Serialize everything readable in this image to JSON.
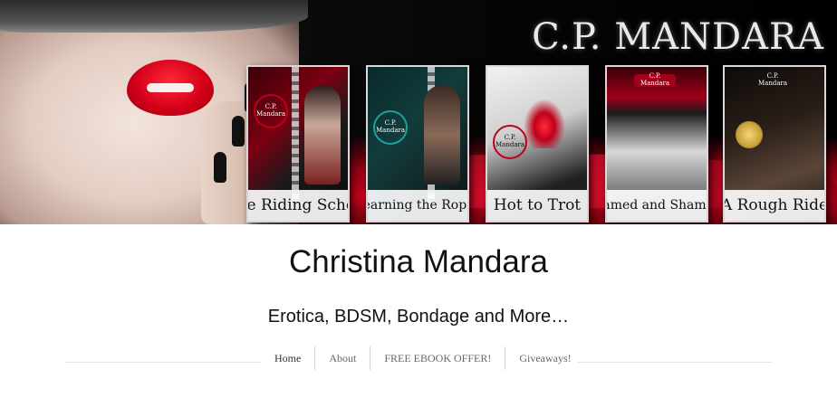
{
  "banner": {
    "brand_text": "C.P. MANDARA",
    "books": [
      {
        "title": "The Riding School",
        "author": "C.P. Mandara",
        "accent": "#c0001a"
      },
      {
        "title": "Learning the Ropes",
        "author": "C.P. Mandara",
        "accent": "#1aa39a"
      },
      {
        "title": "Hot to Trot",
        "author": "C.P. Mandara",
        "accent": "#c0001a"
      },
      {
        "title": "Named and Shamed",
        "author": "C.P. Mandara",
        "accent": "#c0001a"
      },
      {
        "title": "A Rough Ride",
        "author": "C.P. Mandara",
        "accent": "#c0001a"
      }
    ]
  },
  "site": {
    "title": "Christina Mandara",
    "tagline": "Erotica, BDSM, Bondage and More…"
  },
  "nav": {
    "items": [
      {
        "label": "Home",
        "active": true
      },
      {
        "label": "About",
        "active": false
      },
      {
        "label": "FREE EBOOK OFFER!",
        "active": false
      },
      {
        "label": "Giveaways!",
        "active": false
      }
    ]
  },
  "colors": {
    "accent_red": "#c0001a",
    "text": "#111111",
    "nav_text": "#666666",
    "rule": "#e2e2e2"
  }
}
